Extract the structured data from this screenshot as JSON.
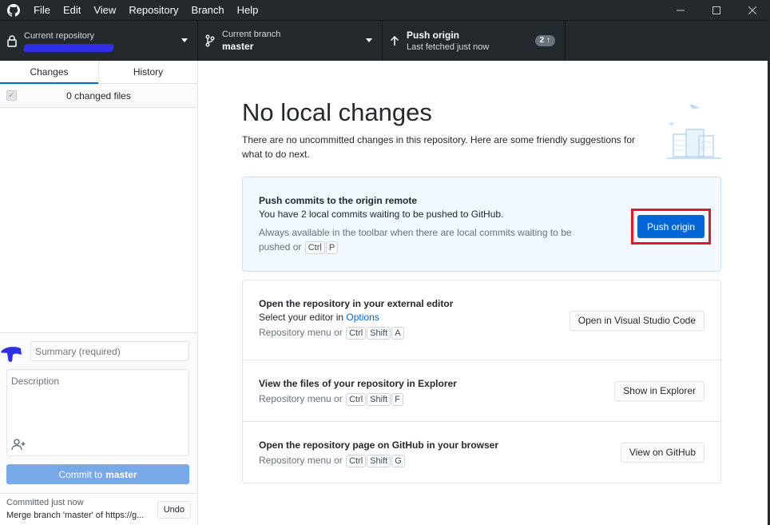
{
  "menu": [
    "File",
    "Edit",
    "View",
    "Repository",
    "Branch",
    "Help"
  ],
  "icons": {
    "app": "github-logo-icon",
    "repo": "lock-icon",
    "branch": "git-branch-icon",
    "push": "arrow-up-icon",
    "coauthor": "person-add-icon"
  },
  "toolbar": {
    "repo_label": "Current repository",
    "branch_label": "Current branch",
    "branch_value": "master",
    "push_label": "Push origin",
    "push_sub": "Last fetched just now",
    "push_count": "2 ↑"
  },
  "sidebar": {
    "tab_changes": "Changes",
    "tab_history": "History",
    "changed_files": "0 changed files",
    "summary_placeholder": "Summary (required)",
    "description_placeholder": "Description",
    "commit_prefix": "Commit to",
    "commit_branch": "master",
    "last_commit_time": "Committed just now",
    "last_commit_msg": "Merge branch 'master' of https://g...",
    "undo_label": "Undo"
  },
  "main": {
    "title": "No local changes",
    "subtitle": "There are no uncommitted changes in this repository. Here are some friendly suggestions for what to do next.",
    "push_card": {
      "title": "Push commits to the origin remote",
      "text": "You have 2 local commits waiting to be pushed to GitHub.",
      "hint": "Always available in the toolbar when there are local commits waiting to be pushed or",
      "keys": [
        "Ctrl",
        "P"
      ],
      "button": "Push origin"
    },
    "editor_row": {
      "title": "Open the repository in your external editor",
      "text_prefix": "Select your editor in",
      "text_link": "Options",
      "hint": "Repository menu or",
      "keys": [
        "Ctrl",
        "Shift",
        "A"
      ],
      "button": "Open in Visual Studio Code"
    },
    "explorer_row": {
      "title": "View the files of your repository in Explorer",
      "hint": "Repository menu or",
      "keys": [
        "Ctrl",
        "Shift",
        "F"
      ],
      "button": "Show in Explorer"
    },
    "github_row": {
      "title": "Open the repository page on GitHub in your browser",
      "hint": "Repository menu or",
      "keys": [
        "Ctrl",
        "Shift",
        "G"
      ],
      "button": "View on GitHub"
    }
  },
  "colors": {
    "titlebar": "#24292e",
    "accent": "#0366d6",
    "highlight_box": "#e01b24",
    "commit_button_disabled": "#79a8e8",
    "redaction": "#2f2fe8"
  }
}
